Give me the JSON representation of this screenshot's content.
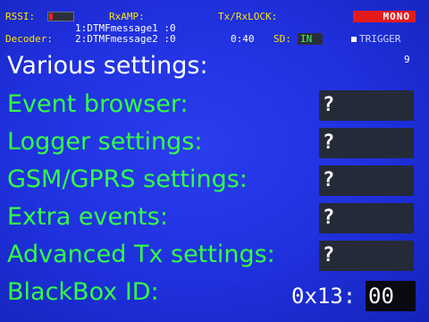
{
  "status": {
    "rssi_label": "RSSI:",
    "rxamp_label": "RxAMP:",
    "txrxlock_label": "Tx/RxLOCK:",
    "mode_badge": "MONO",
    "decoder_label": "Decoder:",
    "line1": "1:DTMFmessage1 :0",
    "line2": "2:DTMFmessage2 :0",
    "time": "0:40",
    "sd_label": "SD:",
    "sd_value": "IN",
    "trigger_label": "TRIGGER",
    "colors": {
      "label": "#ffe600",
      "value": "#33ff55",
      "badge": "#e61a1a"
    }
  },
  "page": {
    "title": "Various settings:",
    "page_number": "9"
  },
  "rows": [
    {
      "label": "Event browser:",
      "value": "?"
    },
    {
      "label": "Logger settings:",
      "value": "?"
    },
    {
      "label": "GSM/GPRS settings:",
      "value": "?"
    },
    {
      "label": "Extra events:",
      "value": "?"
    },
    {
      "label": "Advanced Tx settings:",
      "value": "?"
    }
  ],
  "blackbox": {
    "label": "BlackBox ID:",
    "prefix": "0x13:",
    "selected": "00"
  }
}
